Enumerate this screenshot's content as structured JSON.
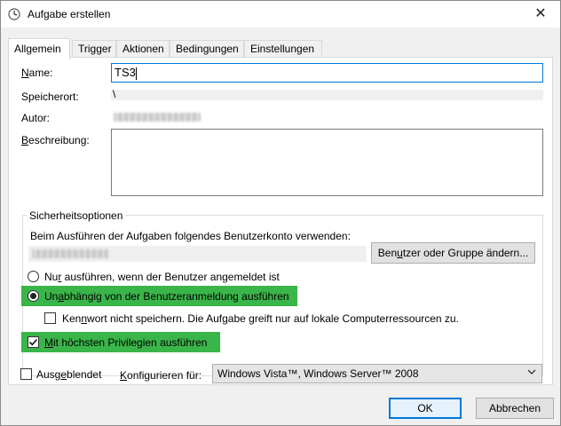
{
  "window": {
    "title": "Aufgabe erstellen",
    "close_glyph": "✕"
  },
  "tabs": [
    {
      "label": "Allgemein",
      "active": true
    },
    {
      "label": "Trigger"
    },
    {
      "label": "Aktionen"
    },
    {
      "label": "Bedingungen"
    },
    {
      "label": "Einstellungen"
    }
  ],
  "general": {
    "name_label_u": "N",
    "name_label_rest": "ame:",
    "name_value": "TS3",
    "location_label": "Speicherort:",
    "location_value": "\\",
    "author_label": "Autor:",
    "description_label_u": "B",
    "description_label_rest": "eschreibung:"
  },
  "security": {
    "group_title": "Sicherheitsoptionen",
    "account_prompt": "Beim Ausführen der Aufgaben folgendes Benutzerkonto verwenden:",
    "change_user_pre": "Ben",
    "change_user_u": "u",
    "change_user_post": "tzer oder Gruppe ändern...",
    "radio_logged_on_pre": "Nu",
    "radio_logged_on_u": "r",
    "radio_logged_on_post": " ausführen, wenn der Benutzer angemeldet ist",
    "radio_logged_on_checked": false,
    "radio_independent_pre": "Un",
    "radio_independent_u": "a",
    "radio_independent_post": "bhängig von der Benutzeranmeldung ausführen",
    "radio_independent_checked": true,
    "no_password_pre": "Ken",
    "no_password_u": "n",
    "no_password_post": "wort nicht speichern. Die Aufgabe greift nur auf lokale Computerressourcen zu.",
    "no_password_checked": false,
    "highest_priv_u": "M",
    "highest_priv_rest": "it höchsten Privilegien ausführen",
    "highest_priv_checked": true,
    "highlight_color": "#3ab54a"
  },
  "bottom": {
    "hidden_pre": "Ausg",
    "hidden_u": "e",
    "hidden_post": "blendet",
    "hidden_checked": false,
    "configure_u": "K",
    "configure_rest": "onfigurieren für:",
    "configure_value": "Windows Vista™, Windows Server™ 2008"
  },
  "buttons": {
    "ok": "OK",
    "cancel": "Abbrechen"
  }
}
